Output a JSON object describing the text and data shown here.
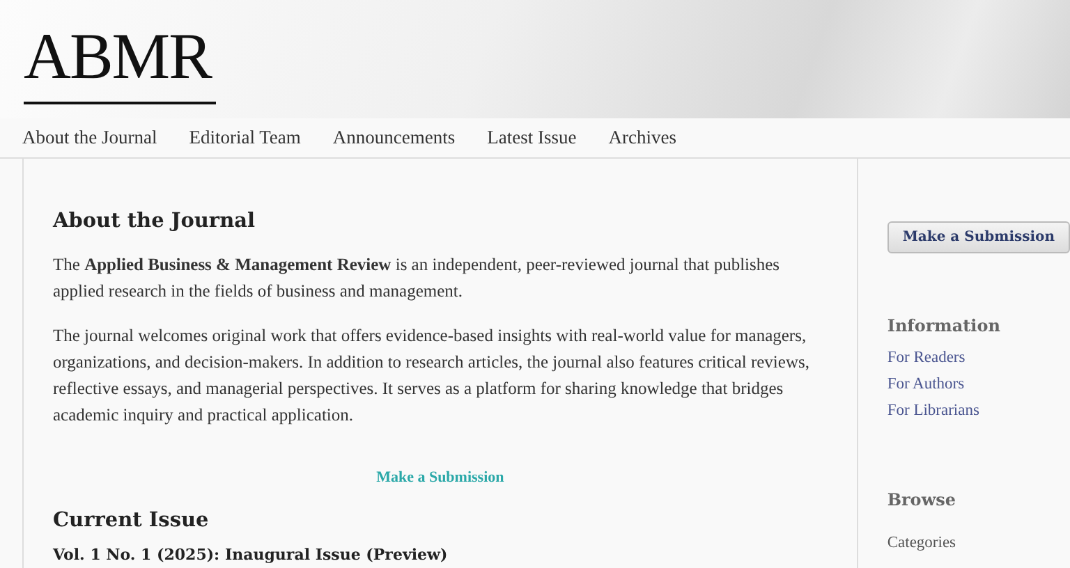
{
  "header": {
    "logo": "ABMR"
  },
  "nav": [
    {
      "label": "About the Journal"
    },
    {
      "label": "Editorial Team"
    },
    {
      "label": "Announcements"
    },
    {
      "label": "Latest Issue"
    },
    {
      "label": "Archives"
    }
  ],
  "main": {
    "title": "About the Journal",
    "paragraphs": [
      "The **Applied Business & Management Review** is an independent, peer-reviewed journal that publishes applied research in the fields of business and management.",
      "The journal welcomes original work that offers evidence-based insights with real-world value for managers, organizations, and decision-makers.  In addition to research articles, the journal also features critical reviews, reflective essays, and managerial perspectives.  It serves as a platform for sharing knowledge that bridges academic inquiry and practical application."
    ],
    "submission_link": "Make a Submission",
    "current_issue": {
      "title": "Current Issue",
      "issue": "Vol. 1 No. 1 (2025): Inaugural Issue (Preview)"
    }
  },
  "sidebar": {
    "submit_button": "Make a Submission",
    "blocks": [
      {
        "title": "Information",
        "links": [
          "For Readers",
          "For Authors",
          "For Librarians"
        ]
      },
      {
        "title": "Browse",
        "links": [
          "Categories"
        ]
      }
    ]
  }
}
